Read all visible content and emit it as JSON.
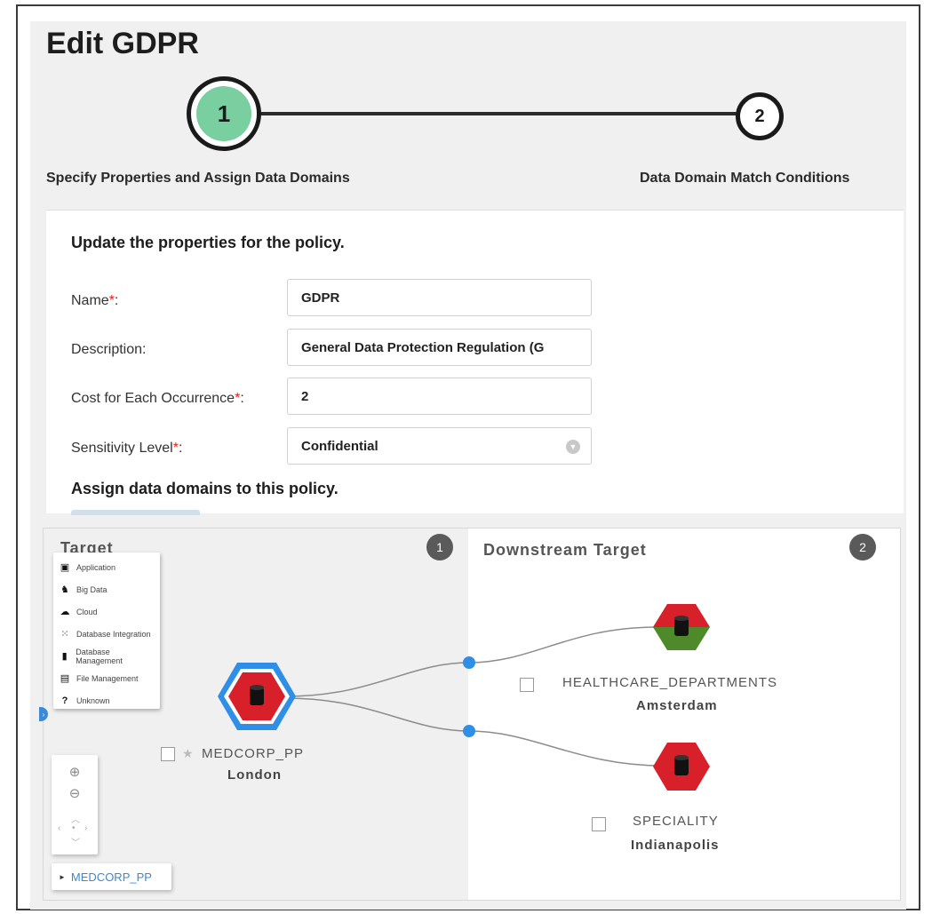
{
  "page": {
    "title": "Edit GDPR"
  },
  "wizard": {
    "steps": [
      {
        "number": "1",
        "label": "Specify Properties and Assign Data Domains"
      },
      {
        "number": "2",
        "label": "Data Domain Match Conditions"
      }
    ]
  },
  "form": {
    "heading": "Update the properties for the policy.",
    "name_label": "Name",
    "name_value": "GDPR",
    "description_label": "Description:",
    "description_value": "General Data Protection Regulation (G",
    "cost_label": "Cost for Each Occurrence",
    "cost_value": "2",
    "sensitivity_label": "Sensitivity Level",
    "sensitivity_value": "Confidential",
    "required_mark": "*",
    "colon": ":",
    "assign_heading": "Assign data domains to this policy."
  },
  "lineage": {
    "target_title": "Target",
    "target_badge": "1",
    "downstream_title": "Downstream Target",
    "downstream_badge": "2",
    "legend": [
      {
        "icon": "application-icon",
        "label": "Application"
      },
      {
        "icon": "big-data-icon",
        "label": "Big Data"
      },
      {
        "icon": "cloud-icon",
        "label": "Cloud"
      },
      {
        "icon": "database-integration-icon",
        "label": "Database Integration"
      },
      {
        "icon": "database-management-icon",
        "label": "Database Management"
      },
      {
        "icon": "file-management-icon",
        "label": "File Management"
      },
      {
        "icon": "unknown-icon",
        "label": "Unknown"
      }
    ],
    "nodes": {
      "source": {
        "name": "MEDCORP_PP",
        "location": "London"
      },
      "downstream1": {
        "name": "HEALTHCARE_DEPARTMENTS",
        "location": "Amsterdam"
      },
      "downstream2": {
        "name": "SPECIALITY",
        "location": "Indianapolis"
      }
    },
    "breadcrumb": "MEDCORP_PP",
    "colors": {
      "node_red": "#d7202a",
      "node_green": "#4e8a2a",
      "selection_blue": "#2f8fe6",
      "step_green": "#79cfa0"
    }
  }
}
